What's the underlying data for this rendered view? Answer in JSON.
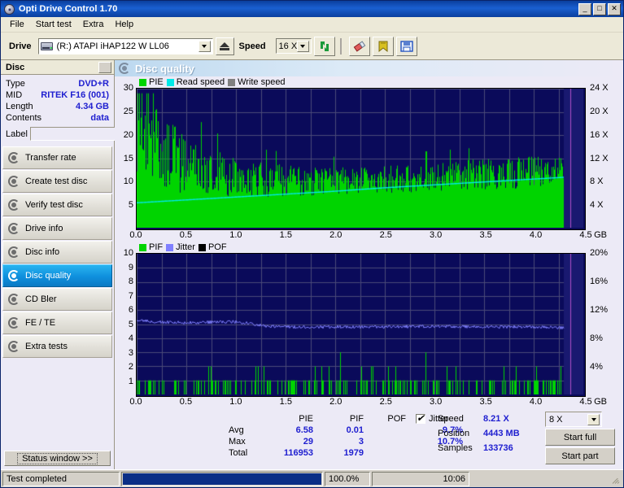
{
  "window": {
    "title": "Opti Drive Control 1.70",
    "icon": "cd-icon",
    "minimize": "_",
    "maximize": "□",
    "close": "✕"
  },
  "menu": {
    "items": [
      "File",
      "Start test",
      "Extra",
      "Help"
    ]
  },
  "toolbar": {
    "drive_label": "Drive",
    "drive_value": "(R:)   ATAPI iHAP122   W LL06",
    "drive_icon": "optical-drive-icon",
    "eject_icon": "eject-icon",
    "speed_label": "Speed",
    "speed_value": "16 X",
    "refresh_icon": "refresh-icon",
    "eraser_icon": "eraser-icon",
    "bookmark_icon": "bookmark-icon",
    "save_icon": "floppy-save-icon"
  },
  "sidebar": {
    "disc_header": "Disc",
    "info": [
      {
        "key": "Type",
        "value": "DVD+R"
      },
      {
        "key": "MID",
        "value": "RITEK F16 (001)"
      },
      {
        "key": "Length",
        "value": "4.34 GB"
      },
      {
        "key": "Contents",
        "value": "data"
      }
    ],
    "label_field": {
      "label": "Label",
      "value": "",
      "placeholder": ""
    },
    "nav": [
      {
        "label": "Transfer rate",
        "active": false
      },
      {
        "label": "Create test disc",
        "active": false
      },
      {
        "label": "Verify test disc",
        "active": false
      },
      {
        "label": "Drive info",
        "active": false
      },
      {
        "label": "Disc info",
        "active": false
      },
      {
        "label": "Disc quality",
        "active": true
      },
      {
        "label": "CD Bler",
        "active": false
      },
      {
        "label": "FE / TE",
        "active": false
      },
      {
        "label": "Extra tests",
        "active": false
      }
    ],
    "status_window_button": "Status window >>"
  },
  "panel": {
    "title": "Disc quality",
    "icon": "disc-quality-icon"
  },
  "stats": {
    "headers": {
      "pie": "PIE",
      "pif": "PIF",
      "pof": "POF",
      "jitter": "Jitter"
    },
    "jitter_checked": true,
    "rows": [
      {
        "label": "Avg",
        "pie": "6.58",
        "pif": "0.01",
        "pof": "",
        "jitter": "9.7%"
      },
      {
        "label": "Max",
        "pie": "29",
        "pif": "3",
        "pof": "",
        "jitter": "10.7%"
      },
      {
        "label": "Total",
        "pie": "116953",
        "pif": "1979",
        "pof": "",
        "jitter": ""
      }
    ],
    "speed_label": "Speed",
    "speed_value": "8.21 X",
    "speed_select": "8 X",
    "position_label": "Position",
    "position_value": "4443 MB",
    "samples_label": "Samples",
    "samples_value": "133736",
    "start_full": "Start full",
    "start_part": "Start part"
  },
  "statusbar": {
    "message": "Test completed",
    "progress_percent": 100.0,
    "progress_text": "100.0%",
    "time": "10:06"
  },
  "colors": {
    "pie_green": "#00d400",
    "read_speed_cyan": "#00e8e8",
    "write_speed_gray": "#808080",
    "pif_green": "#00d400",
    "jitter_blue": "#8080ff",
    "pof_black": "#000000",
    "plot_bg": "#0a0a5a",
    "grid": "#4a4a78",
    "accent": "#2020d0",
    "titlebar": "#0a3f9e"
  },
  "chart_data": [
    {
      "type": "bar",
      "id": "pie-chart",
      "title": "PIE / Read speed / Write speed",
      "legend": [
        {
          "label": "PIE",
          "color": "#00d400"
        },
        {
          "label": "Read speed",
          "color": "#00e8e8"
        },
        {
          "label": "Write speed",
          "color": "#808080"
        }
      ],
      "legend_position": "top-left",
      "grid": true,
      "xlabel": "GB",
      "xlim": [
        0,
        4.5
      ],
      "xticks": [
        0.0,
        0.5,
        1.0,
        1.5,
        2.0,
        2.5,
        3.0,
        3.5,
        4.0,
        4.5
      ],
      "xticklabels": [
        "0.0",
        "0.5",
        "1.0",
        "1.5",
        "2.0",
        "2.5",
        "3.0",
        "3.5",
        "4.0",
        "4.5"
      ],
      "ylabel": "PIE",
      "ylim": [
        0,
        30
      ],
      "yticks": [
        5,
        10,
        15,
        20,
        25,
        30
      ],
      "y2label": "Speed",
      "y2lim": [
        0,
        24
      ],
      "y2ticks": [
        4,
        8,
        12,
        16,
        20,
        24
      ],
      "y2ticklabels": [
        "4 X",
        "8 X",
        "12 X",
        "16 X",
        "20 X",
        "24 X"
      ],
      "data_end_gb": 4.3,
      "series": [
        {
          "name": "PIE",
          "color": "#00d400",
          "kind": "bars",
          "baseline_profile": [
            [
              0.0,
              17.5
            ],
            [
              0.05,
              22.0
            ],
            [
              0.1,
              18.0
            ],
            [
              0.15,
              16.5
            ],
            [
              0.2,
              15.0
            ],
            [
              0.3,
              14.0
            ],
            [
              0.4,
              13.0
            ],
            [
              0.5,
              12.0
            ],
            [
              0.6,
              11.5
            ],
            [
              0.7,
              11.0
            ],
            [
              0.8,
              10.5
            ],
            [
              1.0,
              9.8
            ],
            [
              1.2,
              9.5
            ],
            [
              1.5,
              9.3
            ],
            [
              1.8,
              9.2
            ],
            [
              2.0,
              9.3
            ],
            [
              2.3,
              9.5
            ],
            [
              2.6,
              9.8
            ],
            [
              3.0,
              10.2
            ],
            [
              3.4,
              10.6
            ],
            [
              3.8,
              11.0
            ],
            [
              4.1,
              11.4
            ],
            [
              4.3,
              11.3
            ]
          ],
          "noise_profile": [
            [
              0.0,
              11.0
            ],
            [
              0.2,
              9.0
            ],
            [
              0.5,
              6.5
            ],
            [
              1.0,
              4.0
            ],
            [
              2.0,
              3.0
            ],
            [
              3.0,
              3.2
            ],
            [
              4.0,
              3.5
            ],
            [
              4.3,
              3.2
            ]
          ],
          "peak_max": 29
        },
        {
          "name": "Read speed",
          "color": "#00e8e8",
          "kind": "line",
          "points": [
            [
              0.0,
              4.3
            ],
            [
              0.5,
              4.8
            ],
            [
              1.0,
              5.3
            ],
            [
              1.5,
              5.8
            ],
            [
              2.0,
              6.3
            ],
            [
              2.5,
              6.9
            ],
            [
              3.0,
              7.4
            ],
            [
              3.5,
              7.9
            ],
            [
              4.0,
              8.4
            ],
            [
              4.3,
              8.7
            ]
          ],
          "axis": "y2"
        },
        {
          "name": "Write speed",
          "color": "#808080",
          "kind": "line",
          "points": []
        }
      ]
    },
    {
      "type": "bar",
      "id": "pif-chart",
      "title": "PIF / Jitter / POF",
      "legend": [
        {
          "label": "PIF",
          "color": "#00d400"
        },
        {
          "label": "Jitter",
          "color": "#8080ff"
        },
        {
          "label": "POF",
          "color": "#000000"
        }
      ],
      "legend_position": "top-left",
      "grid": true,
      "xlabel": "GB",
      "xlim": [
        0,
        4.5
      ],
      "xticks": [
        0.0,
        0.5,
        1.0,
        1.5,
        2.0,
        2.5,
        3.0,
        3.5,
        4.0,
        4.5
      ],
      "xticklabels": [
        "0.0",
        "0.5",
        "1.0",
        "1.5",
        "2.0",
        "2.5",
        "3.0",
        "3.5",
        "4.0",
        "4.5"
      ],
      "ylabel": "PIF",
      "ylim": [
        0,
        10
      ],
      "yticks": [
        1,
        2,
        3,
        4,
        5,
        6,
        7,
        8,
        9,
        10
      ],
      "y2label": "Jitter",
      "y2lim": [
        0,
        20
      ],
      "y2ticks": [
        4,
        8,
        12,
        16,
        20
      ],
      "y2ticklabels": [
        "4%",
        "8%",
        "12%",
        "16%",
        "20%"
      ],
      "data_end_gb": 4.3,
      "series": [
        {
          "name": "PIF",
          "color": "#00d400",
          "kind": "bars",
          "typical_value": 1,
          "occasional_value": 2,
          "max_value": 3,
          "density": 0.32
        },
        {
          "name": "Jitter",
          "color": "#8080ff",
          "kind": "line",
          "axis": "y2",
          "points": [
            [
              0.0,
              10.6
            ],
            [
              0.2,
              10.3
            ],
            [
              0.5,
              10.2
            ],
            [
              0.8,
              10.3
            ],
            [
              1.0,
              10.3
            ],
            [
              1.15,
              10.1
            ],
            [
              1.3,
              9.7
            ],
            [
              1.6,
              9.6
            ],
            [
              2.0,
              9.6
            ],
            [
              2.5,
              9.6
            ],
            [
              3.0,
              9.7
            ],
            [
              3.5,
              9.6
            ],
            [
              4.0,
              9.6
            ],
            [
              4.3,
              9.5
            ]
          ]
        },
        {
          "name": "POF",
          "color": "#000000",
          "kind": "bars",
          "points": []
        }
      ]
    }
  ]
}
